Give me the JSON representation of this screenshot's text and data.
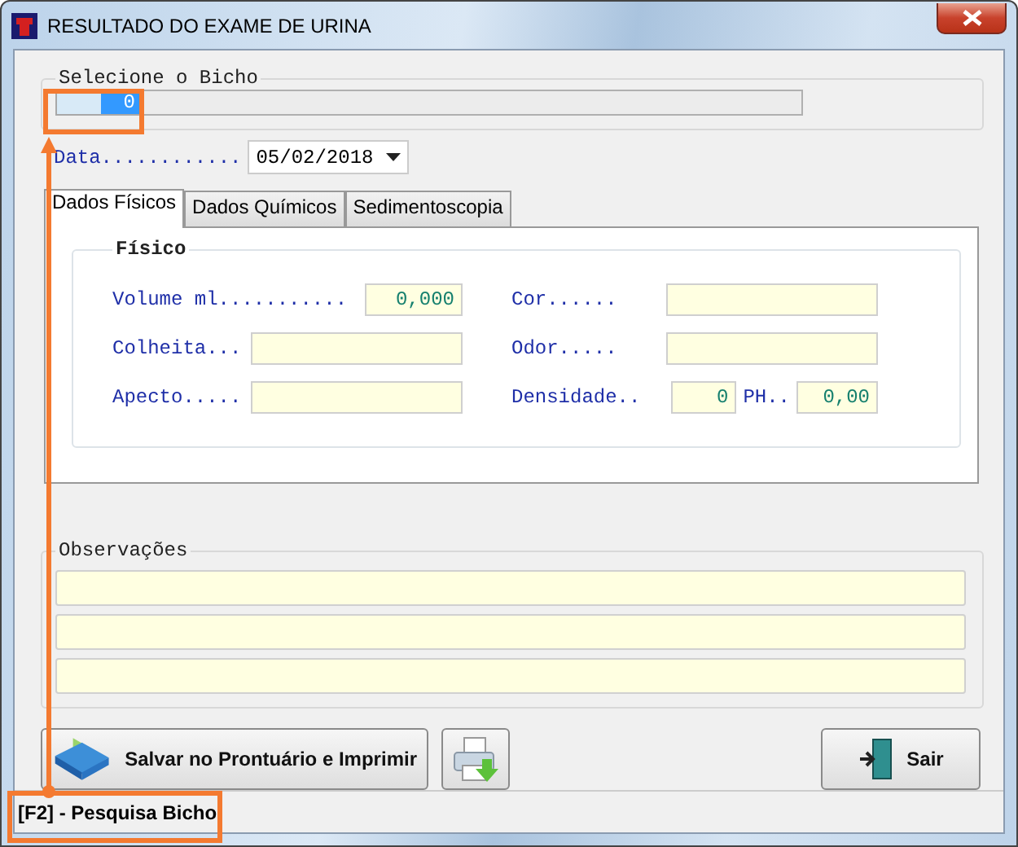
{
  "window": {
    "title": "RESULTADO DO EXAME DE URINA"
  },
  "animal_group": {
    "legend": "Selecione o Bicho",
    "code": "0"
  },
  "date": {
    "label": "Data............",
    "value": "05/02/2018"
  },
  "tabs": [
    {
      "label": "Dados Físicos",
      "selected": true
    },
    {
      "label": "Dados Químicos",
      "selected": false
    },
    {
      "label": "Sedimentoscopia",
      "selected": false
    }
  ],
  "physical": {
    "legend": "Físico",
    "rows": [
      {
        "cells": [
          [
            {
              "kind": "label",
              "text": "Volume ml..........."
            },
            {
              "kind": "number",
              "text": "0,000"
            }
          ],
          [
            {
              "kind": "label",
              "text": "Cor......"
            },
            {
              "kind": "text"
            }
          ]
        ]
      },
      {
        "cells": [
          [
            {
              "kind": "label",
              "text": "Colheita..."
            },
            {
              "kind": "text"
            }
          ],
          [
            {
              "kind": "label",
              "text": "Odor....."
            },
            {
              "kind": "text"
            }
          ]
        ]
      },
      {
        "cells": [
          [
            {
              "kind": "label",
              "text": "Apecto....."
            },
            {
              "kind": "text"
            }
          ],
          [
            {
              "kind": "label",
              "text": "Densidade.."
            },
            {
              "kind": "small",
              "text": "0"
            },
            {
              "kind": "label",
              "text": "PH.."
            },
            {
              "kind": "number",
              "text": "0,00"
            }
          ]
        ]
      }
    ]
  },
  "observations": {
    "legend": "Observações"
  },
  "buttons": [
    {
      "kind": "save",
      "label": "Salvar no Prontuário e Imprimir"
    },
    {
      "kind": "print"
    },
    {
      "kind": "exit",
      "label": "Sair"
    }
  ],
  "status_bar": {
    "text": "[F2] - Pesquisa Bicho"
  }
}
